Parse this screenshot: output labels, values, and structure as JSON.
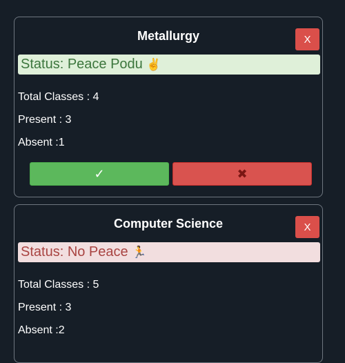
{
  "subjects": [
    {
      "title": "Metallurgy",
      "close_label": "X",
      "status_text": "Status: Peace Podu",
      "status_emoji": "✌",
      "status_kind": "ok",
      "total_classes": "Total Classes : 4",
      "present": "Present : 3",
      "absent": "Absent :1",
      "present_button": "✓",
      "absent_button": "✖"
    },
    {
      "title": "Computer Science",
      "close_label": "X",
      "status_text": "Status: No Peace",
      "status_emoji": "🏃",
      "status_kind": "bad",
      "total_classes": "Total Classes : 5",
      "present": "Present : 3",
      "absent": "Absent :2"
    }
  ],
  "colors": {
    "background": "#161e27",
    "close_button": "#da4f4a",
    "present_button": "#5cb85c",
    "absent_button": "#d9534f",
    "status_ok_bg": "#dff0d9",
    "status_bad_bg": "#f2dedf"
  }
}
